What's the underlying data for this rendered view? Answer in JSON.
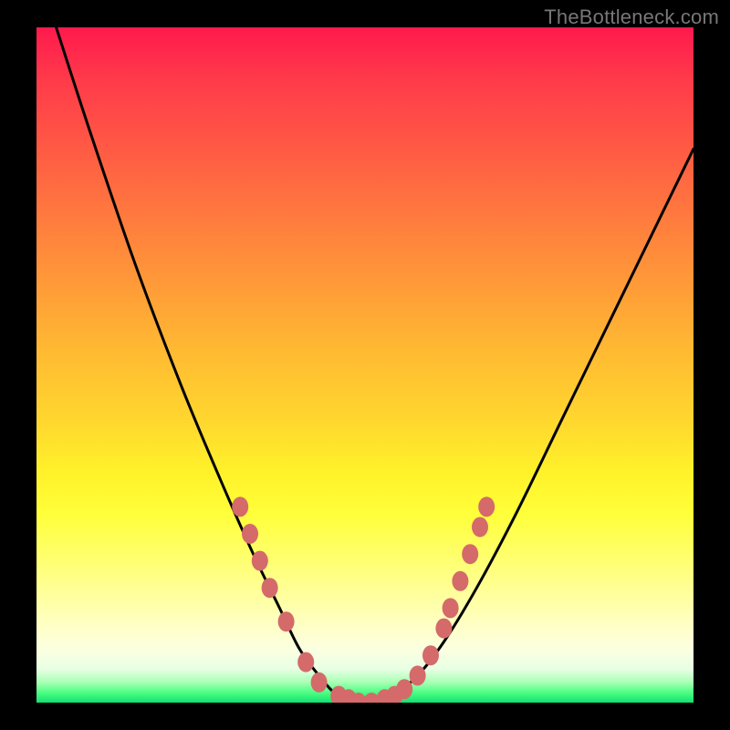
{
  "watermark": "TheBottleneck.com",
  "chart_data": {
    "type": "line",
    "title": "",
    "xlabel": "",
    "ylabel": "",
    "xlim": [
      0,
      100
    ],
    "ylim": [
      0,
      100
    ],
    "grid": false,
    "legend": false,
    "series": [
      {
        "name": "curve",
        "x": [
          3,
          8,
          15,
          22,
          28,
          33,
          37,
          40,
          43,
          46,
          50,
          54,
          58,
          62,
          67,
          73,
          80,
          88,
          96,
          100
        ],
        "y": [
          100,
          85,
          65,
          47,
          33,
          22,
          14,
          8,
          4,
          1,
          0,
          1,
          4,
          9,
          17,
          28,
          42,
          58,
          74,
          82
        ]
      }
    ],
    "markers": [
      {
        "x": 31,
        "y": 29
      },
      {
        "x": 32.5,
        "y": 25
      },
      {
        "x": 34,
        "y": 21
      },
      {
        "x": 35.5,
        "y": 17
      },
      {
        "x": 38,
        "y": 12
      },
      {
        "x": 41,
        "y": 6
      },
      {
        "x": 43,
        "y": 3
      },
      {
        "x": 46,
        "y": 1
      },
      {
        "x": 47.5,
        "y": 0.5
      },
      {
        "x": 49,
        "y": 0
      },
      {
        "x": 51,
        "y": 0
      },
      {
        "x": 53,
        "y": 0.5
      },
      {
        "x": 54.5,
        "y": 1
      },
      {
        "x": 56,
        "y": 2
      },
      {
        "x": 58,
        "y": 4
      },
      {
        "x": 60,
        "y": 7
      },
      {
        "x": 62,
        "y": 11
      },
      {
        "x": 63,
        "y": 14
      },
      {
        "x": 64.5,
        "y": 18
      },
      {
        "x": 66,
        "y": 22
      },
      {
        "x": 67.5,
        "y": 26
      },
      {
        "x": 68.5,
        "y": 29
      }
    ],
    "colors": {
      "curve": "#000000",
      "markers": "#d46a6a",
      "gradient_top": "#ff1a4d",
      "gradient_mid": "#ffff3a",
      "gradient_bottom": "#12e070"
    }
  }
}
